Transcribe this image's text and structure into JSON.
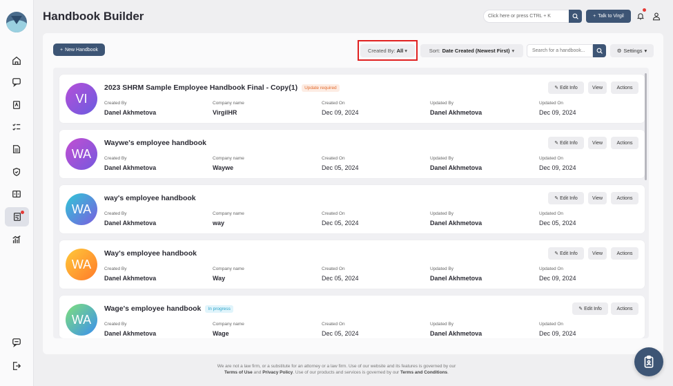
{
  "app": {
    "title": "Handbook Builder"
  },
  "header": {
    "search_placeholder": "Click here or press CTRL + K",
    "talk_label": "Talk to Virgil"
  },
  "toolbar": {
    "new_label": "New Handbook",
    "created_by_label": "Created By:",
    "created_by_value": "All",
    "sort_label": "Sort:",
    "sort_value": "Date Created (Newest First)",
    "search_placeholder": "Search for a handbook...",
    "settings_label": "Settings"
  },
  "labels": {
    "created_by": "Created By",
    "company_name": "Company name",
    "created_on": "Created On",
    "updated_by": "Updated By",
    "updated_on": "Updated On",
    "edit_info": "Edit Info",
    "view": "View",
    "actions": "Actions"
  },
  "handbooks": [
    {
      "initials": "VI",
      "title": "2023 SHRM Sample Employee Handbook Final - Copy(1)",
      "badge": "Update required",
      "badge_type": "warn",
      "created_by": "Danel Akhmetova",
      "company": "VirgilHR",
      "created_on": "Dec 09, 2024",
      "updated_by": "Danel Akhmetova",
      "updated_on": "Dec 09, 2024",
      "color1": "#b64fd8",
      "color2": "#6a5ce0",
      "has_view": true
    },
    {
      "initials": "WA",
      "title": "Waywe's employee handbook",
      "badge": "",
      "badge_type": "",
      "created_by": "Danel Akhmetova",
      "company": "Waywe",
      "created_on": "Dec 05, 2024",
      "updated_by": "Danel Akhmetova",
      "updated_on": "Dec 09, 2024",
      "color1": "#c24fd2",
      "color2": "#7558de",
      "has_view": true
    },
    {
      "initials": "WA",
      "title": "way's employee handbook",
      "badge": "",
      "badge_type": "",
      "created_by": "Danel Akhmetova",
      "company": "way",
      "created_on": "Dec 05, 2024",
      "updated_by": "Danel Akhmetova",
      "updated_on": "Dec 05, 2024",
      "color1": "#2fc8d6",
      "color2": "#7a5de0",
      "has_view": true
    },
    {
      "initials": "WA",
      "title": "Way's employee handbook",
      "badge": "",
      "badge_type": "",
      "created_by": "Danel Akhmetova",
      "company": "Way",
      "created_on": "Dec 05, 2024",
      "updated_by": "Danel Akhmetova",
      "updated_on": "Dec 09, 2024",
      "color1": "#ffc93a",
      "color2": "#ff7a2a",
      "has_view": true
    },
    {
      "initials": "WA",
      "title": "Wage's employee handbook",
      "badge": "In progress",
      "badge_type": "prog",
      "created_by": "Danel Akhmetova",
      "company": "Wage",
      "created_on": "Dec 05, 2024",
      "updated_by": "Danel Akhmetova",
      "updated_on": "Dec 09, 2024",
      "color1": "#7fe07a",
      "color2": "#3a8ff0",
      "has_view": false
    }
  ],
  "footer": {
    "line1": "We are not a law firm, or a substitute for an attorney or a law firm. Use of our website and its features is governed by our",
    "terms_use": "Terms of Use",
    "and": "and",
    "privacy": "Privacy Policy",
    "line2_mid": ". Use of our products and services is governed by our",
    "terms_conditions": "Terms and Conditions",
    "period": "."
  }
}
